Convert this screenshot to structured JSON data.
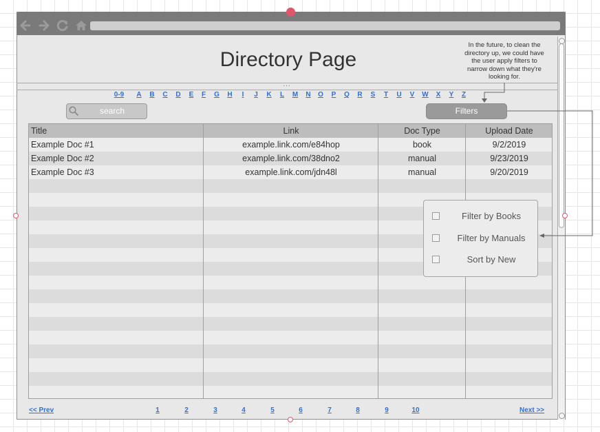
{
  "page": {
    "title": "Directory Page",
    "note": "In the future, to clean the directory up, we could have the user apply filters to narrow down what they're looking for.",
    "ellipsis": "...",
    "search_placeholder": "search",
    "filters_label": "Filters"
  },
  "alphabet": [
    "0-9",
    "A",
    "B",
    "C",
    "D",
    "E",
    "F",
    "G",
    "H",
    "I",
    "J",
    "K",
    "L",
    "M",
    "N",
    "O",
    "P",
    "Q",
    "R",
    "S",
    "T",
    "U",
    "V",
    "W",
    "X",
    "Y",
    "Z"
  ],
  "table": {
    "headers": [
      "Title",
      "Link",
      "Doc Type",
      "Upload Date"
    ],
    "rows": [
      [
        "Example Doc #1",
        "example.link.com/e84hop",
        "book",
        "9/2/2019"
      ],
      [
        "Example Doc #2",
        "example.link.com/38dno2",
        "manual",
        "9/23/2019"
      ],
      [
        "Example Doc #3",
        "example.link.com/jdn48l",
        "manual",
        "9/20/2019"
      ]
    ]
  },
  "filter_menu": [
    "Filter by Books",
    "Filter by Manuals",
    "Sort by New"
  ],
  "pagination": {
    "prev": "<< Prev",
    "next": "Next >>",
    "pages": [
      "1",
      "2",
      "3",
      "4",
      "5",
      "6",
      "7",
      "8",
      "9",
      "10"
    ]
  },
  "colors": {
    "link": "#2f6fd6",
    "handle": "#e0566a",
    "toolbar": "#7a7a7a"
  },
  "icons": [
    "back-arrow-icon",
    "forward-arrow-icon",
    "reload-icon",
    "home-icon",
    "search-icon"
  ]
}
